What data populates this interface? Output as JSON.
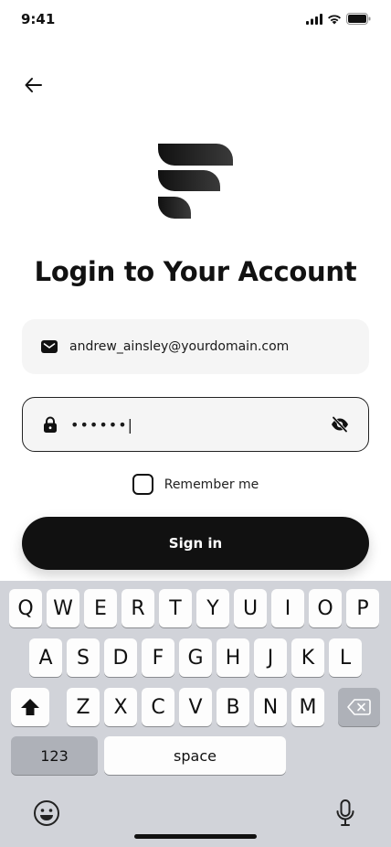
{
  "status_bar": {
    "time": "9:41",
    "icons": [
      "signal-icon",
      "wifi-icon",
      "battery-icon"
    ]
  },
  "header": {
    "back_icon": "arrow-left-icon"
  },
  "brand": {
    "logo_icon": "brand-logo-icon",
    "color": "#111111"
  },
  "title": "Login to Your Account",
  "form": {
    "email": {
      "icon": "mail-icon",
      "value": "andrew_ainsley@yourdomain.com"
    },
    "password": {
      "icon": "lock-icon",
      "value": "••••••|",
      "visibility_icon": "eye-off-icon"
    },
    "remember_label": "Remember me",
    "signin_label": "Sign in"
  },
  "keyboard": {
    "row1": [
      "Q",
      "W",
      "E",
      "R",
      "T",
      "Y",
      "U",
      "I",
      "O",
      "P"
    ],
    "row2": [
      "A",
      "S",
      "D",
      "F",
      "G",
      "H",
      "J",
      "K",
      "L"
    ],
    "row3": [
      "Z",
      "X",
      "C",
      "V",
      "B",
      "N",
      "M"
    ],
    "shift_icon": "shift-icon",
    "delete_icon": "backspace-icon",
    "numbers_label": "123",
    "space_label": "space",
    "emoji_icon": "emoji-icon",
    "mic_icon": "microphone-icon"
  },
  "colors": {
    "primary": "#111111",
    "field_bg": "#f5f5f5",
    "keyboard_bg": "#d1d3d9"
  }
}
